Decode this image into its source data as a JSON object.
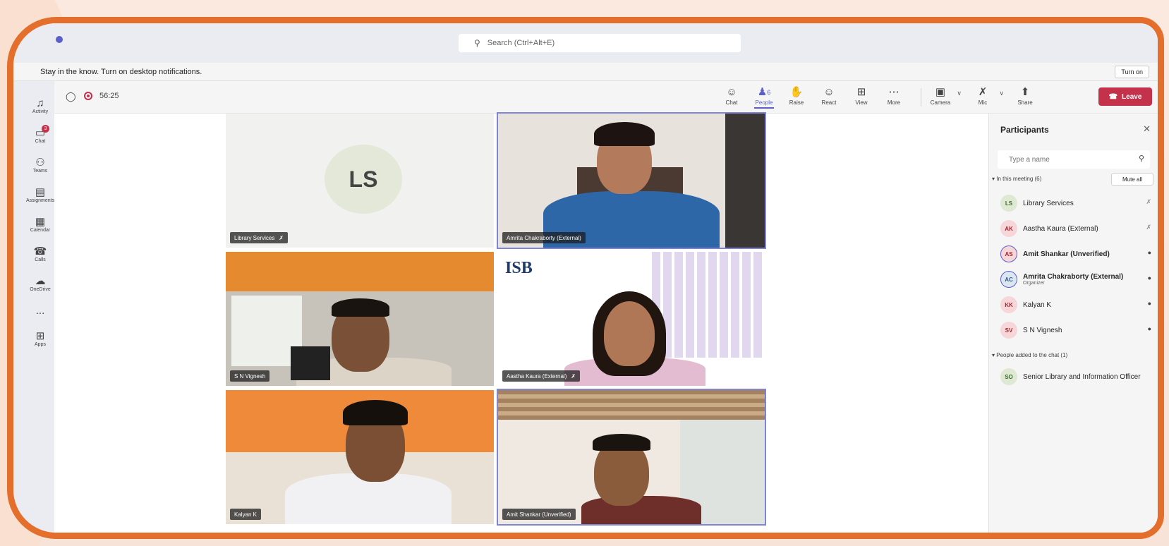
{
  "search": {
    "placeholder": "Search (Ctrl+Alt+E)"
  },
  "notification": {
    "text": "Stay in the know. Turn on desktop notifications.",
    "button": "Turn on"
  },
  "rail": [
    {
      "label": "Activity",
      "icon": "bell-icon"
    },
    {
      "label": "Chat",
      "icon": "chat-icon",
      "badge": "3"
    },
    {
      "label": "Teams",
      "icon": "teams-icon"
    },
    {
      "label": "Assignments",
      "icon": "assignments-icon"
    },
    {
      "label": "Calendar",
      "icon": "calendar-icon"
    },
    {
      "label": "Calls",
      "icon": "phone-icon"
    },
    {
      "label": "OneDrive",
      "icon": "cloud-icon"
    },
    {
      "label": "...",
      "icon": "more-icon"
    },
    {
      "label": "Apps",
      "icon": "apps-icon"
    }
  ],
  "meeting": {
    "timer": "56:25",
    "toolbar": {
      "chat": "Chat",
      "people": "People",
      "people_count": "6",
      "raise": "Raise",
      "react": "React",
      "view": "View",
      "more": "More",
      "camera": "Camera",
      "mic": "Mic",
      "share": "Share",
      "leave": "Leave"
    }
  },
  "tiles": [
    {
      "name": "Library Services",
      "initials": "LS"
    },
    {
      "name": "Amrita Chakraborty (External)"
    },
    {
      "name": "S N Vignesh"
    },
    {
      "name": "Aastha Kaura (External)",
      "logo": "ISB"
    },
    {
      "name": "Kalyan K"
    },
    {
      "name": "Amit Shankar (Unverified)"
    }
  ],
  "panel": {
    "title": "Participants",
    "search_placeholder": "Type a name",
    "in_meeting": "In this meeting (6)",
    "mute_all": "Mute all",
    "participants": [
      {
        "initials": "LS",
        "name": "Library Services",
        "mic": "muted"
      },
      {
        "initials": "AK",
        "name": "Aastha Kaura (External)",
        "mic": "muted"
      },
      {
        "initials": "AS",
        "name": "Amit Shankar (Unverified)",
        "mic": "on"
      },
      {
        "initials": "AC",
        "name": "Amrita Chakraborty (External)",
        "role": "Organizer",
        "mic": "on"
      },
      {
        "initials": "KK",
        "name": "Kalyan K",
        "mic": "on"
      },
      {
        "initials": "SV",
        "name": "S N Vignesh",
        "mic": "on"
      }
    ],
    "added_section": "People added to the chat (1)",
    "added": [
      {
        "initials": "SO",
        "name": "Senior Library and Information Officer"
      }
    ]
  },
  "colors": {
    "frame": "#e46f2c",
    "accent": "#5b5fc7",
    "leave": "#c4314b"
  }
}
